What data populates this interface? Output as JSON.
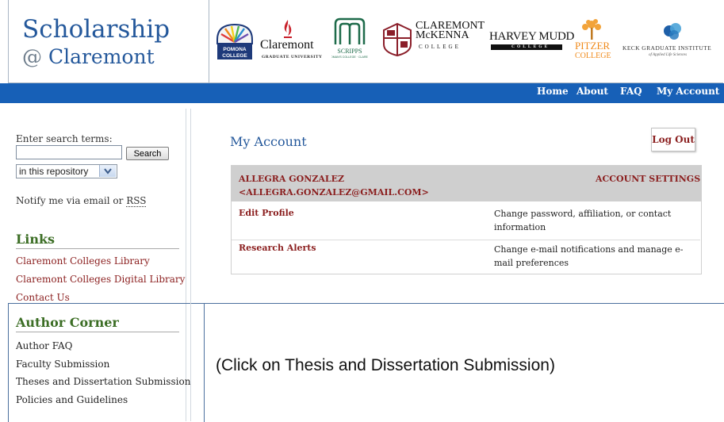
{
  "header": {
    "title_line1": "Scholarship",
    "title_at": "@",
    "title_line2": "Claremont",
    "logos": {
      "pomona": "POMONA COLLEGE",
      "cgu_name": "Claremont",
      "cgu_sub": "GRADUATE UNIVERSITY",
      "scripps_name": "SCRIPPS",
      "scripps_sub": "THE WOMAN'S COLLEGE · CLAREMONT ·",
      "cmc_line1": "CLAREMONT",
      "cmc_line2": "McKENNA",
      "cmc_line3": "COLLEGE",
      "hmc_name": "HARVEY MUDD",
      "hmc_sub": "COLLEGE",
      "pitzer_line1": "PITZER",
      "pitzer_line2": "COLLEGE",
      "kgi_name": "KECK GRADUATE INSTITUTE",
      "kgi_sub": "of Applied Life Sciences"
    }
  },
  "nav": {
    "home": "Home",
    "about": "About",
    "faq": "FAQ",
    "account": "My Account"
  },
  "sidebar": {
    "search_label": "Enter search terms:",
    "search_value": "",
    "search_button": "Search",
    "scope_selected": "in this repository",
    "notify_prefix": "Notify me via email or ",
    "notify_rss": "RSS",
    "links_heading": "Links",
    "links": [
      "Claremont Colleges Library",
      "Claremont Colleges Digital Library",
      "Contact Us"
    ],
    "author_heading": "Author Corner",
    "author_links": [
      "Author FAQ",
      "Faculty Submission",
      "Theses and Dissertation Submission",
      "Policies and Guidelines"
    ]
  },
  "callout": "(Click on Thesis and Dissertation Submission)",
  "main": {
    "title": "My Account",
    "logout": "Log Out",
    "user_name": "ALLEGRA GONZALEZ",
    "user_email": "<ALLEGRA.GONZALEZ@GMAIL.COM>",
    "account_settings": "ACCOUNT SETTINGS",
    "rows": [
      {
        "link": "Edit Profile",
        "desc": "Change password, affiliation, or contact information"
      },
      {
        "link": "Research Alerts",
        "desc": "Change e-mail notifications and manage e-mail preferences"
      }
    ]
  },
  "colors": {
    "brand_blue": "#24589b",
    "nav_blue": "#1760b7",
    "link_maroon": "#8b1f1f",
    "heading_green": "#3c6e25"
  }
}
